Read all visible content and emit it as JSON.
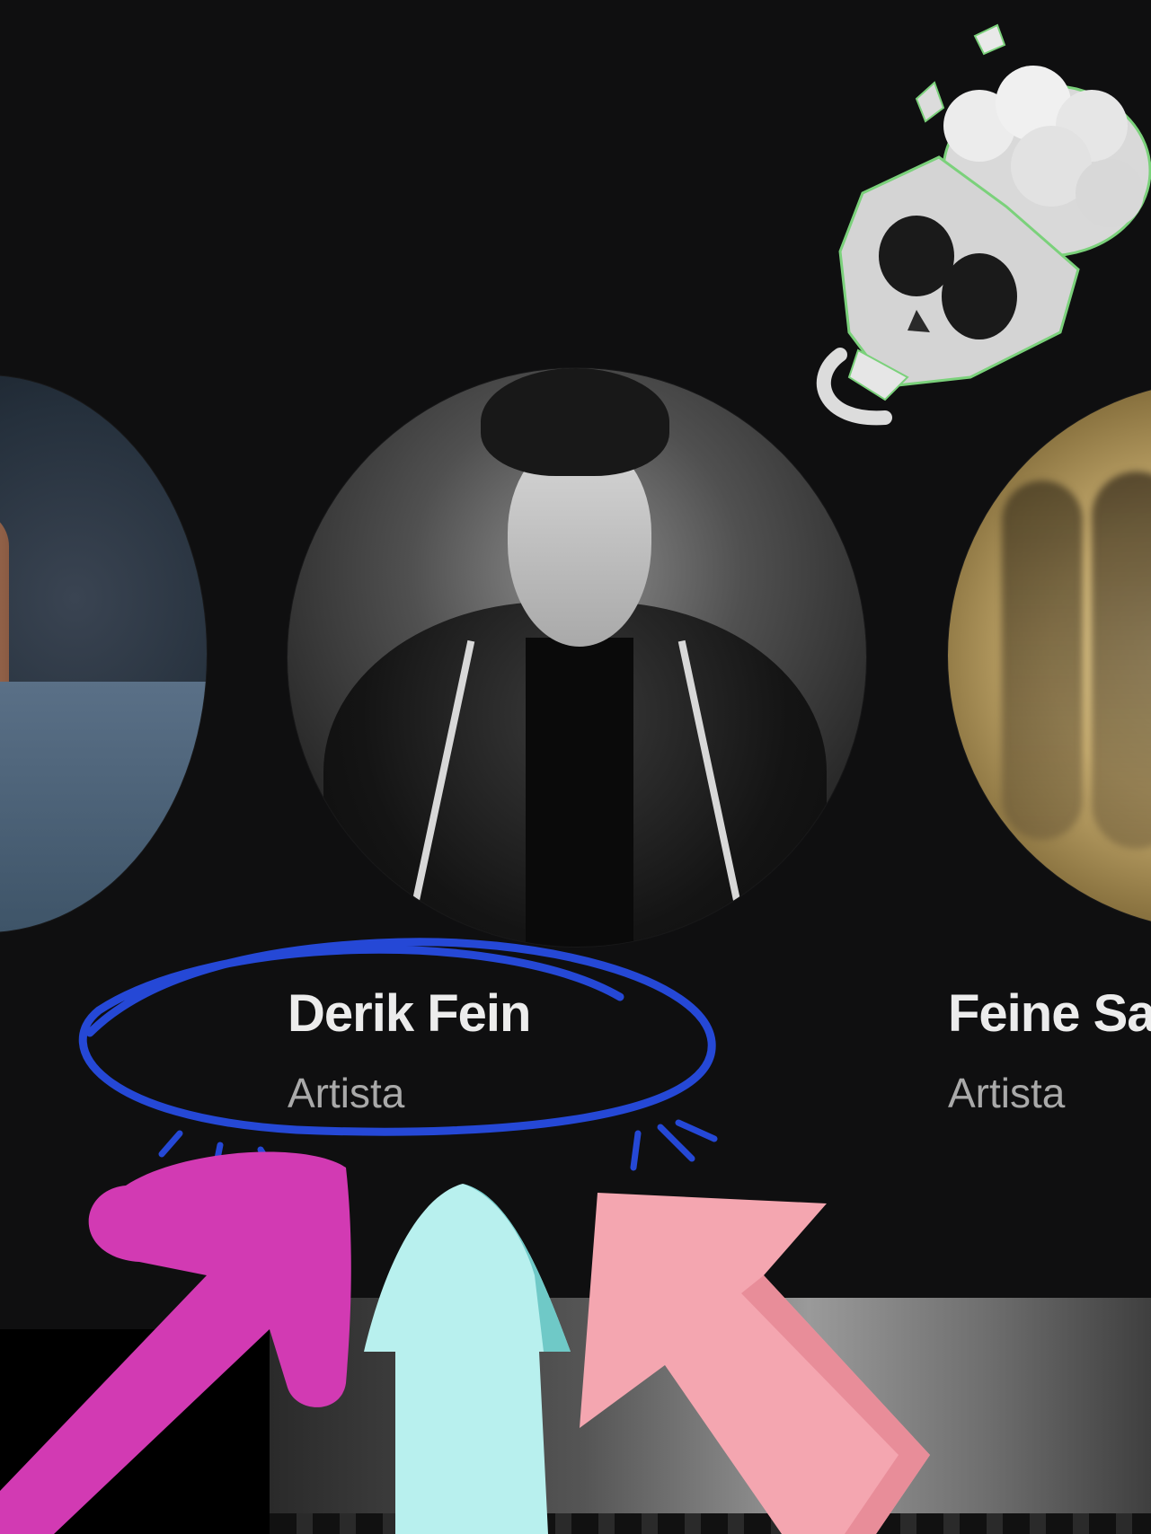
{
  "artists": [
    {
      "name": "",
      "subtitle": ""
    },
    {
      "name": "Derik Fein",
      "subtitle": "Artista"
    },
    {
      "name": "Feine Sa",
      "subtitle": "Artista"
    }
  ],
  "colors": {
    "background": "#0f0f10",
    "name_text": "#ececec",
    "subtitle_text": "#a9a9a9",
    "circle_annotation": "#2548d6",
    "arrow_magenta": "#d23ab3",
    "arrow_cyan": "#b8f0ee",
    "arrow_pink": "#f4a6b0"
  },
  "stickers": [
    "skull-emoji",
    "hand-drawn-circle",
    "magenta-arrow",
    "cyan-arrow",
    "pink-arrow"
  ]
}
